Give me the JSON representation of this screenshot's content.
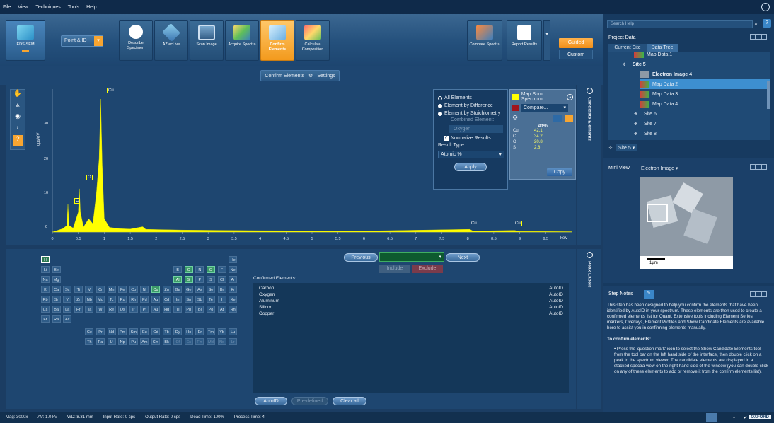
{
  "menu": [
    "File",
    "View",
    "Techniques",
    "Tools",
    "Help"
  ],
  "toolbar": {
    "app_button": "EDS-SEM",
    "mode_dropdown": "Point & ID",
    "buttons": [
      {
        "label": "Describe Specimen",
        "icon": "specimen-icon"
      },
      {
        "label": "AZtecLive",
        "icon": "live-icon"
      },
      {
        "label": "Scan Image",
        "icon": "scan-icon"
      },
      {
        "label": "Acquire Spectra",
        "icon": "acquire-icon"
      },
      {
        "label": "Confirm Elements",
        "icon": "confirm-icon"
      },
      {
        "label": "Calculate Composition",
        "icon": "calc-icon"
      }
    ],
    "right_buttons": [
      {
        "label": "Compare Spectra",
        "icon": "compare-icon"
      },
      {
        "label": "Report Results",
        "icon": "report-icon"
      }
    ],
    "guided": "Guided",
    "custom": "Custom"
  },
  "subbar": {
    "confirm": "Confirm Elements",
    "settings": "Settings"
  },
  "spectrum": {
    "ylabel": "cps/eV",
    "xunit": "keV",
    "peak_labels": [
      "Cu",
      "O",
      "C",
      "Cu",
      "Cu"
    ],
    "y_ticks": [
      "0",
      "10",
      "20",
      "30"
    ],
    "x_ticks": [
      "0",
      "0.5",
      "1",
      "1.5",
      "2",
      "2.5",
      "3",
      "3.5",
      "4",
      "4.5",
      "5",
      "5.5",
      "6",
      "6.5",
      "7",
      "7.5",
      "8",
      "8.5",
      "9",
      "9.5"
    ]
  },
  "quant": {
    "options": [
      "All Elements",
      "Element by Difference",
      "Element by Stoichiometry"
    ],
    "combined_label": "Combined Element:",
    "combined_value": "Oxygen",
    "normalize": "Normalize Results",
    "result_type_label": "Result Type:",
    "result_type": "Atomic %",
    "apply": "Apply",
    "spectrum_name": "Map Sum Spectrum",
    "compare": "Compare...",
    "at_header": "At%",
    "results": [
      {
        "el": "Cu",
        "val": "42.1"
      },
      {
        "el": "C",
        "val": "34.2"
      },
      {
        "el": "O",
        "val": "20.8"
      },
      {
        "el": "Si",
        "val": "2.8"
      }
    ],
    "copy": "Copy"
  },
  "candidate_tab": "Candidate Elements",
  "peak_tab": "Peak Labels",
  "nav": {
    "previous": "Previous",
    "next": "Next",
    "include": "Include",
    "exclude": "Exclude"
  },
  "confirmed": {
    "title": "Confirmed Elements:",
    "items": [
      {
        "name": "Carbon",
        "src": "AutoID"
      },
      {
        "name": "Oxygen",
        "src": "AutoID"
      },
      {
        "name": "Aluminum",
        "src": "AutoID"
      },
      {
        "name": "Silicon",
        "src": "AutoID"
      },
      {
        "name": "Copper",
        "src": "AutoID"
      }
    ],
    "autoid": "AutoID",
    "predefined": "Pre-defined",
    "clear": "Clear all"
  },
  "status": {
    "mag": "Mag: 3000x",
    "av": "AV: 1.0 kV",
    "wd": "WD: 8.31 mm",
    "input": "Input Rate: 0 cps",
    "output": "Output Rate: 0 cps",
    "dead": "Dead Time: 100%",
    "process": "Process Time: 4"
  },
  "right": {
    "search_placeholder": "Search Help",
    "project_title": "Project Data",
    "tabs": [
      "Current Site",
      "Data Tree"
    ],
    "tree": [
      "Map Data 1",
      "Site 5",
      "Electron Image 4",
      "Map Data 2",
      "Map Data 3",
      "Map Data 4",
      "Site 6",
      "Site 7",
      "Site 8"
    ],
    "site_select": "Site 5",
    "mini_view": "Mini View",
    "mini_select": "Electron Image",
    "scale": "1µm",
    "step_notes": "Step Notes",
    "notes_p1": "This step has been designed to help you confirm the elements that have been identified by AutoID in your spectrum. These elements are then used to create a confirmed elements list for Quant. Extensive tools including Element Series markers, Overlays, Element Profiles and Show Candidate Elements are available here to assist you in confirming elements manually.",
    "notes_h": "To confirm elements:",
    "notes_li": "Press the 'question mark' icon to select the Show Candidate Elements tool from the tool bar on the left hand side of the interface, then double click on a peak in the spectrum viewer. The candidate elements are displayed in a stacked spectra view on the right hand side of the window (you can double click on any of these elements to add or remove it from the confirm elements list)."
  },
  "colors": {
    "accent": "#f7a531",
    "spectrum": "#ffff00",
    "highlight": "#3c9a6a"
  }
}
